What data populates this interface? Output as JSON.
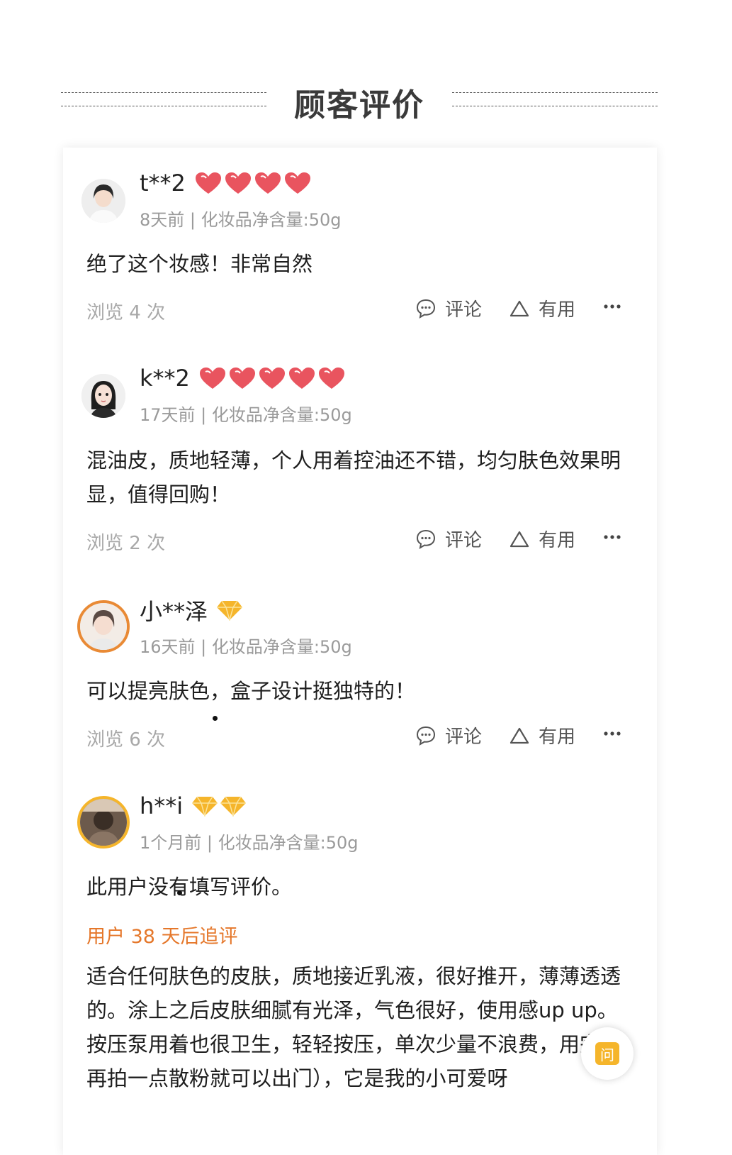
{
  "section_title": "顾客评价",
  "colors": {
    "accent_orange": "#e5772a",
    "heart_red": "#e9545f",
    "gem_gold": "#f5b52b",
    "muted_gray": "#9a9a9a"
  },
  "reviews": [
    {
      "username": "t**2",
      "badge_type": "heart",
      "badge_count": 4,
      "meta": "8天前 | 化妆品净含量:50g",
      "content": "绝了这个妆感！非常自然",
      "views": "浏览 4 次",
      "comment_label": "评论",
      "useful_label": "有用"
    },
    {
      "username": "k**2",
      "badge_type": "heart",
      "badge_count": 5,
      "meta": "17天前 | 化妆品净含量:50g",
      "content": "混油皮，质地轻薄，个人用着控油还不错，均匀肤色效果明显，值得回购！",
      "views": "浏览 2 次",
      "comment_label": "评论",
      "useful_label": "有用"
    },
    {
      "username": "小**泽",
      "badge_type": "gem",
      "badge_count": 1,
      "meta": "16天前 | 化妆品净含量:50g",
      "content": "可以提亮肤色，盒子设计挺独特的！",
      "views": "浏览 6 次",
      "comment_label": "评论",
      "useful_label": "有用"
    },
    {
      "username": "h**i",
      "badge_type": "gem",
      "badge_count": 2,
      "meta": "1个月前 | 化妆品净含量:50g",
      "content": "此用户没有填写评价。",
      "followup_label": "用户 38 天后追评",
      "followup_content": "适合任何肤色的皮肤，质地接近乳液，很好推开，薄薄透透的。涂上之后皮肤细腻有光泽，气色很好，使用感up up。按压泵用着也很卫生，轻轻按压，单次少量不浪费，用完后再拍一点散粉就可以出门），它是我的小可爱呀"
    }
  ],
  "float_button": {
    "label": "问"
  }
}
